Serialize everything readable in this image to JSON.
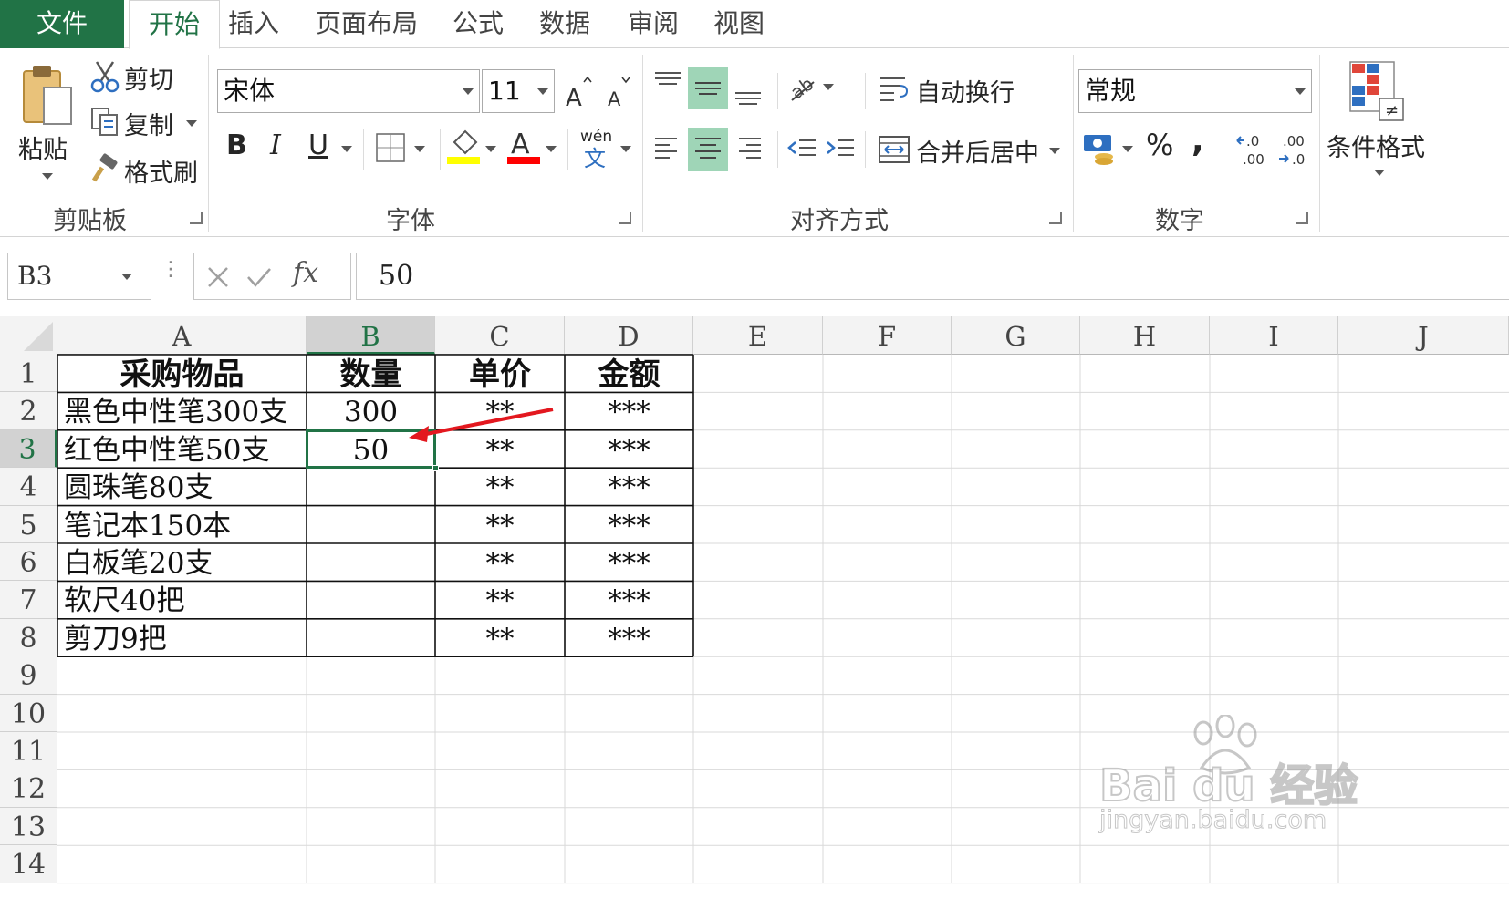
{
  "tabs": {
    "file": "文件",
    "items": [
      "开始",
      "插入",
      "页面布局",
      "公式",
      "数据",
      "审阅",
      "视图"
    ]
  },
  "ribbon": {
    "clipboard": {
      "paste": "粘贴",
      "cut": "剪切",
      "copy": "复制",
      "format_painter": "格式刷",
      "group": "剪贴板"
    },
    "font": {
      "name": "宋体",
      "size": "11",
      "bold": "B",
      "italic": "I",
      "underline": "U",
      "phonetic_top": "wén",
      "phonetic_bottom": "文",
      "group": "字体"
    },
    "alignment": {
      "wrap_text": "自动换行",
      "merge_center": "合并后居中",
      "group": "对齐方式"
    },
    "number": {
      "format": "常规",
      "percent": "%",
      "comma": ",",
      "group": "数字"
    },
    "styles": {
      "conditional_format": "条件格式"
    }
  },
  "formula_bar": {
    "name_box": "B3",
    "fx": "fx",
    "value": "50"
  },
  "columns": [
    "A",
    "B",
    "C",
    "D",
    "E",
    "F",
    "G",
    "H",
    "I",
    "J"
  ],
  "rows": [
    "1",
    "2",
    "3",
    "4",
    "5",
    "6",
    "7",
    "8",
    "9",
    "10",
    "11",
    "12",
    "13",
    "14"
  ],
  "table": {
    "headers": [
      "采购物品",
      "数量",
      "单价",
      "金额"
    ],
    "rows": [
      [
        "黑色中性笔300支",
        "300",
        "**",
        "***"
      ],
      [
        "红色中性笔50支",
        "50",
        "**",
        "***"
      ],
      [
        "圆珠笔80支",
        "",
        "**",
        "***"
      ],
      [
        "笔记本150本",
        "",
        "**",
        "***"
      ],
      [
        "白板笔20支",
        "",
        "**",
        "***"
      ],
      [
        "软尺40把",
        "",
        "**",
        "***"
      ],
      [
        "剪刀9把",
        "",
        "**",
        "***"
      ]
    ]
  },
  "selected_cell": "B3",
  "watermark": {
    "brand": "Bai du 经验",
    "url": "jingyan.baidu.com"
  },
  "colors": {
    "accent": "#217346",
    "arrow": "#e3181f",
    "fill_yellow": "#ffff00",
    "font_red": "#ff0000"
  }
}
